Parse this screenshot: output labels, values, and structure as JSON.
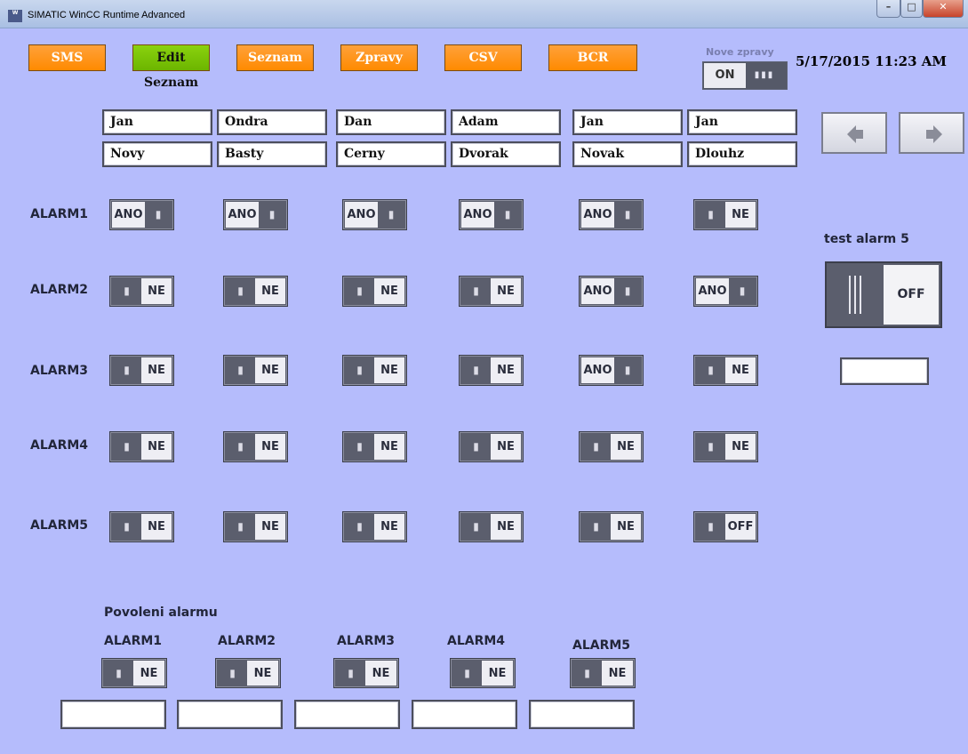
{
  "window": {
    "title": "SIMATIC WinCC Runtime Advanced",
    "app_icon": "WinCC\nRT"
  },
  "modes": [
    {
      "label": "SMS",
      "active": false
    },
    {
      "label": "Edit Seznam",
      "active": true
    },
    {
      "label": "Seznam",
      "active": false
    },
    {
      "label": "Zpravy",
      "active": false
    },
    {
      "label": "CSV",
      "active": false
    },
    {
      "label": "BCR",
      "active": false
    }
  ],
  "new_messages": {
    "label": "Nove zpravy",
    "state": "ON"
  },
  "datetime": "5/17/2015 11:23 AM",
  "contacts": [
    {
      "first": "Jan",
      "last": "Novy"
    },
    {
      "first": "Ondra",
      "last": "Basty"
    },
    {
      "first": "Dan",
      "last": "Cerny"
    },
    {
      "first": "Adam",
      "last": "Dvorak"
    },
    {
      "first": "Jan",
      "last": "Novak"
    },
    {
      "first": "Jan",
      "last": "Dlouhz"
    }
  ],
  "nav": {
    "prev_icon": "arrow-left-icon",
    "next_icon": "arrow-right-icon"
  },
  "alarms": {
    "labels": [
      "ALARM1",
      "ALARM2",
      "ALARM3",
      "ALARM4",
      "ALARM5"
    ],
    "grid": [
      [
        "ANO",
        "ANO",
        "ANO",
        "ANO",
        "ANO",
        "NE"
      ],
      [
        "NE",
        "NE",
        "NE",
        "NE",
        "ANO",
        "ANO"
      ],
      [
        "NE",
        "NE",
        "NE",
        "NE",
        "ANO",
        "NE"
      ],
      [
        "NE",
        "NE",
        "NE",
        "NE",
        "NE",
        "NE"
      ],
      [
        "NE",
        "NE",
        "NE",
        "NE",
        "NE",
        "OFF"
      ]
    ]
  },
  "test_alarm": {
    "label": "test alarm 5",
    "state": "OFF",
    "value": ""
  },
  "enable": {
    "title": "Povoleni alarmu",
    "items": [
      {
        "label": "ALARM1",
        "state": "NE",
        "value": ""
      },
      {
        "label": "ALARM2",
        "state": "NE",
        "value": ""
      },
      {
        "label": "ALARM3",
        "state": "NE",
        "value": ""
      },
      {
        "label": "ALARM4",
        "state": "NE",
        "value": ""
      },
      {
        "label": "ALARM5",
        "state": "NE",
        "value": ""
      }
    ]
  },
  "colors": {
    "background": "#b5bcfc",
    "mode_button": "#ff9314",
    "mode_active": "#7cc400"
  }
}
